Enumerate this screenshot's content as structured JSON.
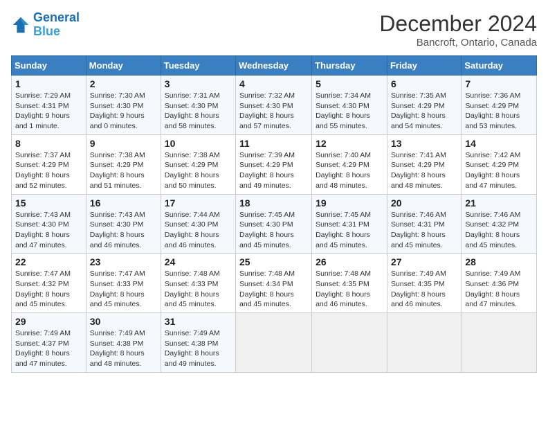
{
  "header": {
    "logo_line1": "General",
    "logo_line2": "Blue",
    "title": "December 2024",
    "subtitle": "Bancroft, Ontario, Canada"
  },
  "weekdays": [
    "Sunday",
    "Monday",
    "Tuesday",
    "Wednesday",
    "Thursday",
    "Friday",
    "Saturday"
  ],
  "weeks": [
    [
      {
        "day": "1",
        "sunrise": "Sunrise: 7:29 AM",
        "sunset": "Sunset: 4:31 PM",
        "daylight": "Daylight: 9 hours and 1 minute."
      },
      {
        "day": "2",
        "sunrise": "Sunrise: 7:30 AM",
        "sunset": "Sunset: 4:30 PM",
        "daylight": "Daylight: 9 hours and 0 minutes."
      },
      {
        "day": "3",
        "sunrise": "Sunrise: 7:31 AM",
        "sunset": "Sunset: 4:30 PM",
        "daylight": "Daylight: 8 hours and 58 minutes."
      },
      {
        "day": "4",
        "sunrise": "Sunrise: 7:32 AM",
        "sunset": "Sunset: 4:30 PM",
        "daylight": "Daylight: 8 hours and 57 minutes."
      },
      {
        "day": "5",
        "sunrise": "Sunrise: 7:34 AM",
        "sunset": "Sunset: 4:30 PM",
        "daylight": "Daylight: 8 hours and 55 minutes."
      },
      {
        "day": "6",
        "sunrise": "Sunrise: 7:35 AM",
        "sunset": "Sunset: 4:29 PM",
        "daylight": "Daylight: 8 hours and 54 minutes."
      },
      {
        "day": "7",
        "sunrise": "Sunrise: 7:36 AM",
        "sunset": "Sunset: 4:29 PM",
        "daylight": "Daylight: 8 hours and 53 minutes."
      }
    ],
    [
      {
        "day": "8",
        "sunrise": "Sunrise: 7:37 AM",
        "sunset": "Sunset: 4:29 PM",
        "daylight": "Daylight: 8 hours and 52 minutes."
      },
      {
        "day": "9",
        "sunrise": "Sunrise: 7:38 AM",
        "sunset": "Sunset: 4:29 PM",
        "daylight": "Daylight: 8 hours and 51 minutes."
      },
      {
        "day": "10",
        "sunrise": "Sunrise: 7:38 AM",
        "sunset": "Sunset: 4:29 PM",
        "daylight": "Daylight: 8 hours and 50 minutes."
      },
      {
        "day": "11",
        "sunrise": "Sunrise: 7:39 AM",
        "sunset": "Sunset: 4:29 PM",
        "daylight": "Daylight: 8 hours and 49 minutes."
      },
      {
        "day": "12",
        "sunrise": "Sunrise: 7:40 AM",
        "sunset": "Sunset: 4:29 PM",
        "daylight": "Daylight: 8 hours and 48 minutes."
      },
      {
        "day": "13",
        "sunrise": "Sunrise: 7:41 AM",
        "sunset": "Sunset: 4:29 PM",
        "daylight": "Daylight: 8 hours and 48 minutes."
      },
      {
        "day": "14",
        "sunrise": "Sunrise: 7:42 AM",
        "sunset": "Sunset: 4:29 PM",
        "daylight": "Daylight: 8 hours and 47 minutes."
      }
    ],
    [
      {
        "day": "15",
        "sunrise": "Sunrise: 7:43 AM",
        "sunset": "Sunset: 4:30 PM",
        "daylight": "Daylight: 8 hours and 47 minutes."
      },
      {
        "day": "16",
        "sunrise": "Sunrise: 7:43 AM",
        "sunset": "Sunset: 4:30 PM",
        "daylight": "Daylight: 8 hours and 46 minutes."
      },
      {
        "day": "17",
        "sunrise": "Sunrise: 7:44 AM",
        "sunset": "Sunset: 4:30 PM",
        "daylight": "Daylight: 8 hours and 46 minutes."
      },
      {
        "day": "18",
        "sunrise": "Sunrise: 7:45 AM",
        "sunset": "Sunset: 4:30 PM",
        "daylight": "Daylight: 8 hours and 45 minutes."
      },
      {
        "day": "19",
        "sunrise": "Sunrise: 7:45 AM",
        "sunset": "Sunset: 4:31 PM",
        "daylight": "Daylight: 8 hours and 45 minutes."
      },
      {
        "day": "20",
        "sunrise": "Sunrise: 7:46 AM",
        "sunset": "Sunset: 4:31 PM",
        "daylight": "Daylight: 8 hours and 45 minutes."
      },
      {
        "day": "21",
        "sunrise": "Sunrise: 7:46 AM",
        "sunset": "Sunset: 4:32 PM",
        "daylight": "Daylight: 8 hours and 45 minutes."
      }
    ],
    [
      {
        "day": "22",
        "sunrise": "Sunrise: 7:47 AM",
        "sunset": "Sunset: 4:32 PM",
        "daylight": "Daylight: 8 hours and 45 minutes."
      },
      {
        "day": "23",
        "sunrise": "Sunrise: 7:47 AM",
        "sunset": "Sunset: 4:33 PM",
        "daylight": "Daylight: 8 hours and 45 minutes."
      },
      {
        "day": "24",
        "sunrise": "Sunrise: 7:48 AM",
        "sunset": "Sunset: 4:33 PM",
        "daylight": "Daylight: 8 hours and 45 minutes."
      },
      {
        "day": "25",
        "sunrise": "Sunrise: 7:48 AM",
        "sunset": "Sunset: 4:34 PM",
        "daylight": "Daylight: 8 hours and 45 minutes."
      },
      {
        "day": "26",
        "sunrise": "Sunrise: 7:48 AM",
        "sunset": "Sunset: 4:35 PM",
        "daylight": "Daylight: 8 hours and 46 minutes."
      },
      {
        "day": "27",
        "sunrise": "Sunrise: 7:49 AM",
        "sunset": "Sunset: 4:35 PM",
        "daylight": "Daylight: 8 hours and 46 minutes."
      },
      {
        "day": "28",
        "sunrise": "Sunrise: 7:49 AM",
        "sunset": "Sunset: 4:36 PM",
        "daylight": "Daylight: 8 hours and 47 minutes."
      }
    ],
    [
      {
        "day": "29",
        "sunrise": "Sunrise: 7:49 AM",
        "sunset": "Sunset: 4:37 PM",
        "daylight": "Daylight: 8 hours and 47 minutes."
      },
      {
        "day": "30",
        "sunrise": "Sunrise: 7:49 AM",
        "sunset": "Sunset: 4:38 PM",
        "daylight": "Daylight: 8 hours and 48 minutes."
      },
      {
        "day": "31",
        "sunrise": "Sunrise: 7:49 AM",
        "sunset": "Sunset: 4:38 PM",
        "daylight": "Daylight: 8 hours and 49 minutes."
      },
      null,
      null,
      null,
      null
    ]
  ]
}
